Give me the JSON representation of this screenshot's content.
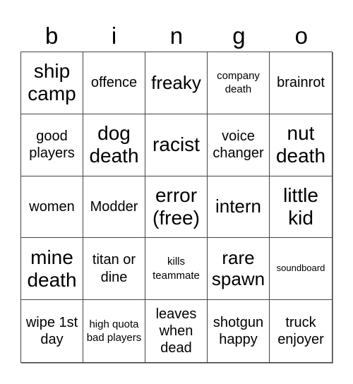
{
  "header": {
    "letters": [
      "b",
      "i",
      "n",
      "g",
      "o"
    ]
  },
  "cells": [
    "ship camp",
    "offence",
    "freaky",
    "company death",
    "brainrot",
    "good players",
    "dog death",
    "racist",
    "voice changer",
    "nut death",
    "women",
    "Modder",
    "error (free)",
    "intern",
    "little kid",
    "mine death",
    "titan or dine",
    "kills teammate",
    "rare spawn",
    "soundboard",
    "wipe 1st day",
    "high quota bad players",
    "leaves when dead",
    "shotgun happy",
    "truck enjoyer"
  ]
}
